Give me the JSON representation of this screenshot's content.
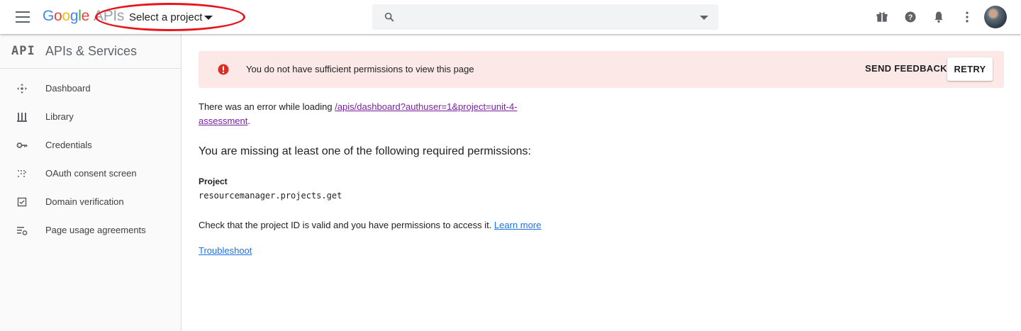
{
  "header": {
    "logo_letters": [
      "G",
      "o",
      "o",
      "g",
      "l",
      "e"
    ],
    "logo_suffix": "APIs",
    "project_selector_label": "Select a project",
    "icons": [
      "menu-icon",
      "search-icon",
      "gift-icon",
      "help-icon",
      "notifications-icon",
      "more-vert-icon"
    ],
    "colors": {
      "google_blue": "#4285f4",
      "google_red": "#ea4335",
      "google_yellow": "#fbbc05",
      "google_green": "#34a853",
      "annotation": "#e8141c"
    }
  },
  "sidebar": {
    "badge": "API",
    "title": "APIs & Services",
    "items": [
      {
        "label": "Dashboard",
        "icon": "dashboard-icon"
      },
      {
        "label": "Library",
        "icon": "library-icon"
      },
      {
        "label": "Credentials",
        "icon": "key-icon"
      },
      {
        "label": "OAuth consent screen",
        "icon": "oauth-icon"
      },
      {
        "label": "Domain verification",
        "icon": "checkbox-icon"
      },
      {
        "label": "Page usage agreements",
        "icon": "settings-list-icon"
      }
    ]
  },
  "alert": {
    "message": "You do not have sufficient permissions to view this page",
    "feedback_label": "SEND FEEDBACK",
    "retry_label": "RETRY",
    "color_bg": "#fce8e6",
    "color_icon": "#d93025"
  },
  "content": {
    "error_prefix": "There was an error while loading ",
    "error_link": "/apis/dashboard?authuser=1&project=unit-4-assessment",
    "error_suffix": ".",
    "missing_heading": "You are missing at least one of the following required permissions:",
    "project_label": "Project",
    "permission": "resourcemanager.projects.get",
    "check_text": "Check that the project ID is valid and you have permissions to access it. ",
    "learn_more": "Learn more",
    "troubleshoot": "Troubleshoot"
  }
}
